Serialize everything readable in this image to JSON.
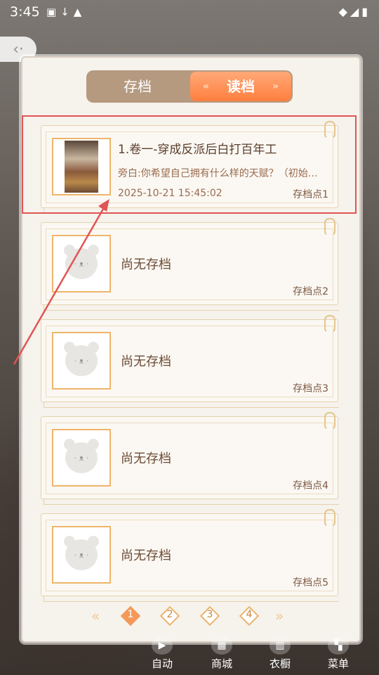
{
  "status_bar": {
    "time": "3:45"
  },
  "tabs": {
    "save_label": "存档",
    "load_label": "读档",
    "active": "读档"
  },
  "slots": [
    {
      "title": "1.卷一-穿成反派后白打百年工",
      "desc": "旁白:你希望自己拥有什么样的天赋？（初始…",
      "timestamp": "2025-10-21 15:45:02",
      "slot_label": "存档点1"
    },
    {
      "empty_text": "尚无存档",
      "slot_label": "存档点2"
    },
    {
      "empty_text": "尚无存档",
      "slot_label": "存档点3"
    },
    {
      "empty_text": "尚无存档",
      "slot_label": "存档点4"
    },
    {
      "empty_text": "尚无存档",
      "slot_label": "存档点5"
    }
  ],
  "pager": {
    "pages": [
      "1",
      "2",
      "3",
      "4"
    ],
    "current": "1"
  },
  "bottom_bar": {
    "auto": "自动",
    "shop": "商城",
    "wardrobe": "衣橱",
    "menu": "菜单"
  },
  "colors": {
    "accent": "#ff8a4a",
    "highlight": "#e05555"
  }
}
